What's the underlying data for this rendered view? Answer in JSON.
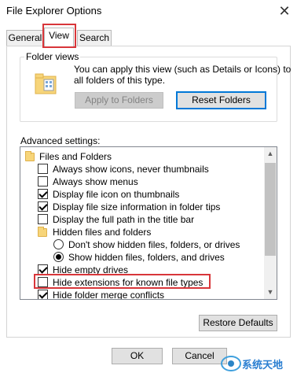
{
  "window": {
    "title": "File Explorer Options",
    "close_glyph": "✕"
  },
  "tabs": [
    {
      "label": "General"
    },
    {
      "label": "View"
    },
    {
      "label": "Search"
    }
  ],
  "folder_views": {
    "group_label": "Folder views",
    "description_line1": "You can apply this view (such as Details or Icons) to",
    "description_line2": "all folders of this type.",
    "apply_button": "Apply to Folders",
    "reset_button": "Reset Folders"
  },
  "advanced": {
    "label": "Advanced settings:",
    "items": [
      {
        "kind": "folder",
        "label": "Files and Folders"
      },
      {
        "kind": "checkbox",
        "checked": false,
        "label": "Always show icons, never thumbnails"
      },
      {
        "kind": "checkbox",
        "checked": false,
        "label": "Always show menus"
      },
      {
        "kind": "checkbox",
        "checked": true,
        "label": "Display file icon on thumbnails"
      },
      {
        "kind": "checkbox",
        "checked": true,
        "label": "Display file size information in folder tips"
      },
      {
        "kind": "checkbox",
        "checked": false,
        "label": "Display the full path in the title bar"
      },
      {
        "kind": "folder",
        "label": "Hidden files and folders"
      },
      {
        "kind": "radio",
        "checked": false,
        "label": "Don't show hidden files, folders, or drives"
      },
      {
        "kind": "radio",
        "checked": true,
        "label": "Show hidden files, folders, and drives"
      },
      {
        "kind": "checkbox",
        "checked": true,
        "label": "Hide empty drives"
      },
      {
        "kind": "checkbox",
        "checked": false,
        "label": "Hide extensions for known file types"
      },
      {
        "kind": "checkbox",
        "checked": true,
        "label": "Hide folder merge conflicts"
      }
    ]
  },
  "footer": {
    "restore_button": "Restore Defaults",
    "ok_button": "OK",
    "cancel_button": "Cancel"
  },
  "watermark": {
    "text": "系统天地"
  },
  "colors": {
    "highlight_red": "#d8363a",
    "focus_blue": "#0078d7"
  }
}
